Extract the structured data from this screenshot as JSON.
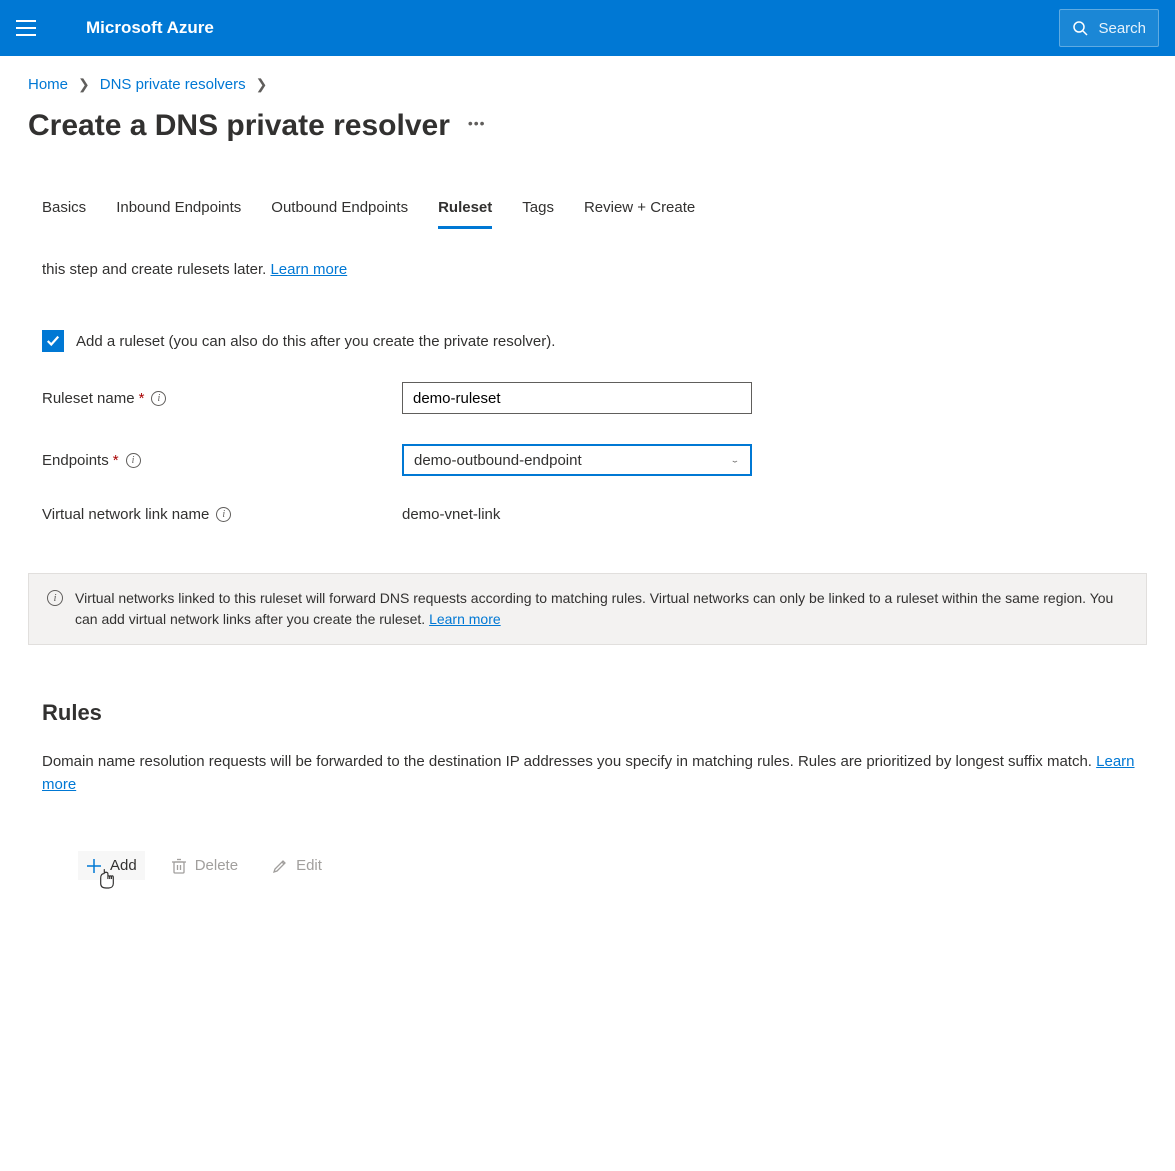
{
  "topbar": {
    "brand": "Microsoft Azure",
    "search_placeholder": "Search"
  },
  "breadcrumb": {
    "items": [
      "Home",
      "DNS private resolvers"
    ]
  },
  "page": {
    "title": "Create a DNS private resolver"
  },
  "tabs": {
    "items": [
      "Basics",
      "Inbound Endpoints",
      "Outbound Endpoints",
      "Ruleset",
      "Tags",
      "Review + Create"
    ],
    "active_index": 3
  },
  "intro": {
    "text_fragment": "this step and create rulesets later. ",
    "learn_more": "Learn more"
  },
  "checkbox": {
    "label": "Add a ruleset (you can also do this after you create the private resolver).",
    "checked": true
  },
  "form": {
    "ruleset_name": {
      "label": "Ruleset name",
      "value": "demo-ruleset"
    },
    "endpoints": {
      "label": "Endpoints",
      "value": "demo-outbound-endpoint"
    },
    "vnet_link": {
      "label": "Virtual network link name",
      "value": "demo-vnet-link"
    }
  },
  "banner": {
    "text": "Virtual networks linked to this ruleset will forward DNS requests according to matching rules. Virtual networks can only be linked to a ruleset within the same region. You can add virtual network links after you create the ruleset. ",
    "learn_more": "Learn more"
  },
  "rules": {
    "title": "Rules",
    "description": "Domain name resolution requests will be forwarded to the destination IP addresses you specify in matching rules. Rules are prioritized by longest suffix match. ",
    "learn_more": "Learn more"
  },
  "toolbar": {
    "add": "Add",
    "delete": "Delete",
    "edit": "Edit"
  }
}
